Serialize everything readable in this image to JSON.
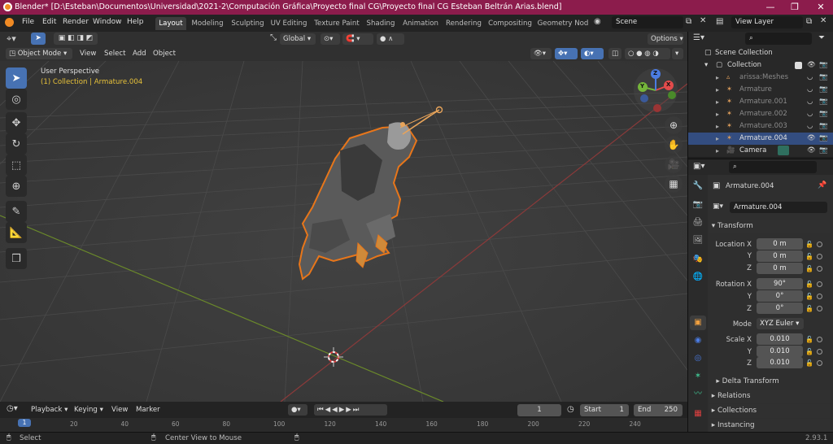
{
  "window": {
    "title": "Blender* [D:\\Esteban\\Documentos\\Universidad\\2021-2\\Computación Gráfica\\Proyecto final CG\\Proyecto final CG Esteban Beltrán Arias.blend]",
    "minimize": "—",
    "maximize": "❐",
    "close": "✕"
  },
  "menu": [
    "File",
    "Edit",
    "Render",
    "Window",
    "Help"
  ],
  "workspaces": [
    "Layout",
    "Modeling",
    "Sculpting",
    "UV Editing",
    "Texture Paint",
    "Shading",
    "Animation",
    "Rendering",
    "Compositing",
    "Geometry Nod"
  ],
  "active_workspace": "Layout",
  "scene": {
    "label": "Scene"
  },
  "view_layer": {
    "label": "View Layer"
  },
  "toolbar": {
    "transform_orientation": "Global",
    "options": "Options"
  },
  "viewport_header": {
    "mode": "Object Mode",
    "view": "View",
    "select": "Select",
    "add": "Add",
    "object": "Object"
  },
  "viewport": {
    "perspective": "User Perspective",
    "collection_info": "(1) Collection | Armature.004"
  },
  "gizmo": {
    "x": "X",
    "y": "Y",
    "z": "Z"
  },
  "outliner": {
    "scene_collection": "Scene Collection",
    "collection": "Collection",
    "items": [
      {
        "name": "arissa:Meshes",
        "dim": true,
        "selected": false
      },
      {
        "name": "Armature",
        "dim": true,
        "selected": false
      },
      {
        "name": "Armature.001",
        "dim": true,
        "selected": false
      },
      {
        "name": "Armature.002",
        "dim": true,
        "selected": false
      },
      {
        "name": "Armature.003",
        "dim": true,
        "selected": false
      },
      {
        "name": "Armature.004",
        "dim": false,
        "selected": true
      },
      {
        "name": "Camera",
        "dim": false,
        "selected": false
      }
    ]
  },
  "properties": {
    "object_name": "Armature.004",
    "data_name": "Armature.004",
    "transform_title": "Transform",
    "location_label": "Location X",
    "rotation_label": "Rotation X",
    "scale_label": "Scale X",
    "y_label": "Y",
    "z_label": "Z",
    "location": [
      "0 m",
      "0 m",
      "0 m"
    ],
    "rotation": [
      "90°",
      "0°",
      "0°"
    ],
    "mode_label": "Mode",
    "mode_value": "XYZ Euler",
    "scale": [
      "0.010",
      "0.010",
      "0.010"
    ],
    "delta_transform": "Delta Transform",
    "relations": "Relations",
    "collections": "Collections",
    "instancing": "Instancing"
  },
  "timeline": {
    "playback": "Playback",
    "keying": "Keying",
    "view": "View",
    "marker": "Marker",
    "current_frame": "1",
    "start_label": "Start",
    "start": "1",
    "end_label": "End",
    "end": "250",
    "ticks": [
      "1",
      "20",
      "40",
      "60",
      "80",
      "100",
      "120",
      "140",
      "160",
      "180",
      "200",
      "220",
      "240"
    ]
  },
  "status": {
    "select": "Select",
    "center": "Center View to Mouse",
    "version": "2.93.1"
  },
  "colors": {
    "title_bar": "#8c1c4c",
    "accent": "#4772b3",
    "selection_outline": "#e8761a"
  }
}
